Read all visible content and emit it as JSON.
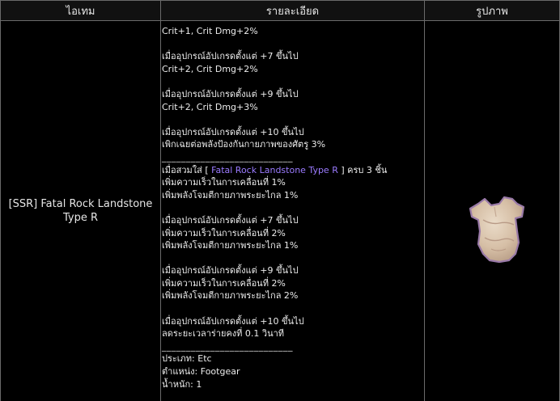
{
  "columns": {
    "item": "ไอเทม",
    "details": "รายละเอียด",
    "image": "รูปภาพ"
  },
  "item": {
    "name": "[SSR] Fatal Rock Landstone Type R",
    "image_icon": "rock-armor-icon"
  },
  "details": {
    "l1": "Crit+1, Crit Dmg+2%",
    "l2": "เมื่ออุปกรณ์อัปเกรดตั้งแต่ +7 ขึ้นไป",
    "l3": "Crit+2, Crit Dmg+2%",
    "l4": "เมื่ออุปกรณ์อัปเกรดตั้งแต่ +9 ขึ้นไป",
    "l5": "Crit+2, Crit Dmg+3%",
    "l6": "เมื่ออุปกรณ์อัปเกรดตั้งแต่ +10 ขึ้นไป",
    "l7": "เพิกเฉยต่อพลังป้องกันกายภาพของศัตรู 3%",
    "divider": "___________________________",
    "set_prefix": "เมื่อสวมใส่ [ ",
    "set_name": "Fatal Rock Landstone Type R",
    "set_suffix": " ] ครบ 3 ชิ้น",
    "s1": "เพิ่มความเร็วในการเคลื่อนที่ 1%",
    "s2": "เพิ่มพลังโจมตีกายภาพระยะไกล 1%",
    "s3": "เมื่ออุปกรณ์อัปเกรดตั้งแต่ +7 ขึ้นไป",
    "s4": "เพิ่มความเร็วในการเคลื่อนที่ 2%",
    "s5": "เพิ่มพลังโจมตีกายภาพระยะไกล 1%",
    "s6": "เมื่ออุปกรณ์อัปเกรดตั้งแต่ +9 ขึ้นไป",
    "s7": "เพิ่มความเร็วในการเคลื่อนที่ 2%",
    "s8": "เพิ่มพลังโจมตีกายภาพระยะไกล 2%",
    "s9": "เมื่ออุปกรณ์อัปเกรดตั้งแต่ +10 ขึ้นไป",
    "s10": "ลดระยะเวลาร่ายคงที่ 0.1 วินาที",
    "type": "ประเภท: Etc",
    "position": "ตำแหน่ง: Footgear",
    "weight": "น้ำหนัก: 1"
  },
  "colors": {
    "background": "#000000",
    "border": "#6a6a6a",
    "set_name": "#9b7bff",
    "rock_main": "#d9c3ac",
    "rock_outline": "#9a7aa8"
  }
}
